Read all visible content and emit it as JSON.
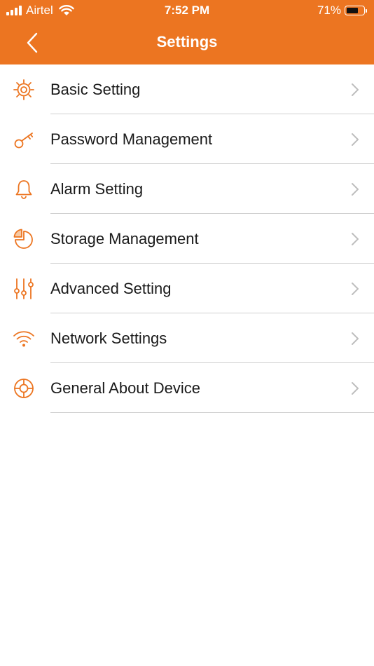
{
  "theme": {
    "accent": "#ec7521",
    "text": "#1a1a1a",
    "divider": "#cfcfcf",
    "chevron": "#bdbdbd"
  },
  "status_bar": {
    "carrier": "Airtel",
    "time": "7:52 PM",
    "battery_percent": "71%",
    "battery_level": 0.71
  },
  "header": {
    "title": "Settings",
    "back_icon": "chevron-left-icon"
  },
  "menu": {
    "items": [
      {
        "label": "Basic Setting",
        "icon": "gear-sun-icon"
      },
      {
        "label": "Password Management",
        "icon": "key-icon"
      },
      {
        "label": "Alarm Setting",
        "icon": "bell-icon"
      },
      {
        "label": "Storage Management",
        "icon": "pie-chart-icon"
      },
      {
        "label": "Advanced Setting",
        "icon": "sliders-icon"
      },
      {
        "label": "Network Settings",
        "icon": "wifi-icon"
      },
      {
        "label": "General About Device",
        "icon": "lifebuoy-icon"
      }
    ]
  }
}
